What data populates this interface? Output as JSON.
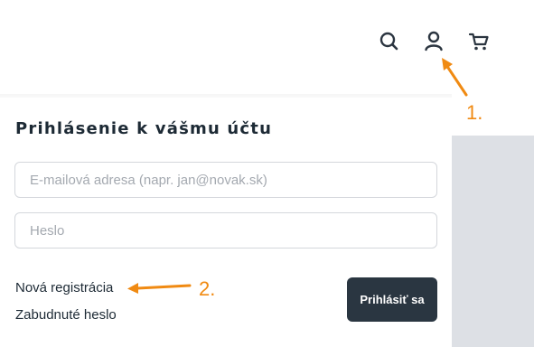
{
  "header": {
    "icons": [
      "search-icon",
      "user-icon",
      "cart-icon"
    ],
    "icon_color": "#2b3540"
  },
  "annotations": {
    "step_1": "1.",
    "step_2": "2.",
    "color": "#f08a12"
  },
  "login": {
    "title": "Prihlásenie k vášmu účtu",
    "email_placeholder": "E-mailová adresa (napr. jan@novak.sk)",
    "password_placeholder": "Heslo",
    "register_link": "Nová registrácia",
    "forgot_link": "Zabudnuté heslo",
    "submit_label": "Prihlásiť sa",
    "button_color": "#2a3641"
  },
  "colors": {
    "side_panel": "#dde0e5",
    "text": "#1d2a35"
  }
}
